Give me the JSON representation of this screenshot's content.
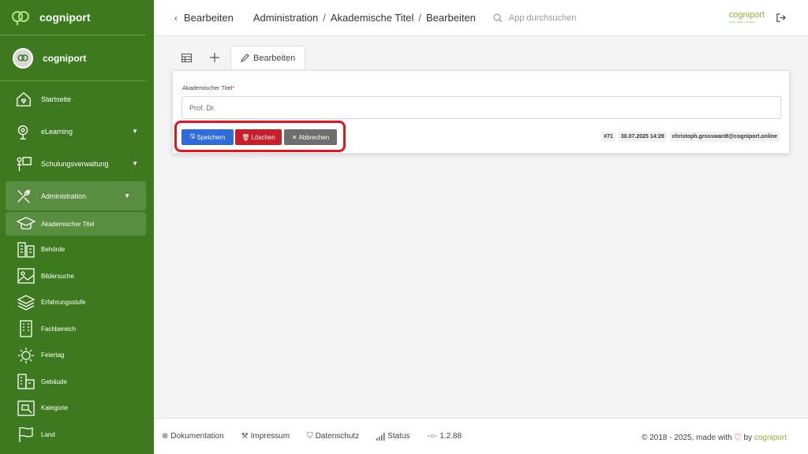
{
  "sidebar": {
    "brand": "cogniport",
    "user": "cogniport",
    "items": [
      {
        "label": "Startseite"
      },
      {
        "label": "eLearning"
      },
      {
        "label": "Schulungsverwaltung"
      },
      {
        "label": "Administration"
      }
    ],
    "subitems": [
      {
        "label": "Akademischer Titel"
      },
      {
        "label": "Behörde"
      },
      {
        "label": "Bildersuche"
      },
      {
        "label": "Erfahrungsstufe"
      },
      {
        "label": "Fachbereich"
      },
      {
        "label": "Feiertag"
      },
      {
        "label": "Gebäude"
      },
      {
        "label": "Kategorie"
      },
      {
        "label": "Land"
      }
    ]
  },
  "header": {
    "back_label": "Bearbeiten",
    "breadcrumb": [
      "Administration",
      "Akademische Titel",
      "Bearbeiten"
    ],
    "search_placeholder": "App durchsuchen",
    "logo_text": "cogniport",
    "logo_tagline": "Sicher. Wissen. Schaffen."
  },
  "tabs": {
    "edit_label": "Bearbeiten"
  },
  "form": {
    "field_label": "Akademischer Titel",
    "required_mark": "*",
    "field_value": "Prof. Dr.",
    "save_label": "Speichern",
    "delete_label": "Löschen",
    "cancel_label": "Abbrechen",
    "meta": {
      "id": "#71",
      "datetime": "30.07.2025 14:29",
      "user": "christoph.grosswardt@cogniport.online"
    }
  },
  "footer": {
    "links": [
      "Dokumentation",
      "Impressum",
      "Datenschutz",
      "Status"
    ],
    "version": "1.2.88",
    "copyright": "© 2018 - 2025, made with",
    "by": "by",
    "brand": "cogniport"
  },
  "colors": {
    "sidebar": "#3d7a1f",
    "accent_green": "#8ab83a",
    "save": "#2f6bd9",
    "delete": "#c81f2c",
    "cancel": "#6e6e6e",
    "highlight": "#e8121c"
  }
}
